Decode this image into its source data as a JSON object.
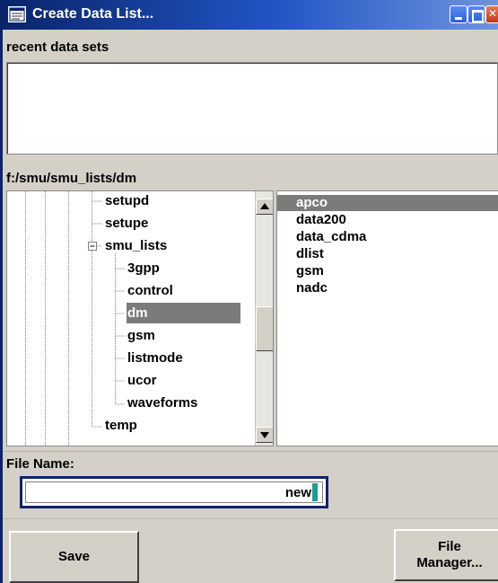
{
  "window": {
    "title": "Create Data List...",
    "icon": "data-list-icon"
  },
  "recent": {
    "label": "recent data sets",
    "items": []
  },
  "path": "f:/smu/smu_lists/dm",
  "tree": {
    "items": [
      {
        "label": "setupd",
        "depth": 1,
        "expander": false
      },
      {
        "label": "setupe",
        "depth": 1,
        "expander": false
      },
      {
        "label": "smu_lists",
        "depth": 1,
        "expander": true
      },
      {
        "label": "3gpp",
        "depth": 2,
        "expander": false
      },
      {
        "label": "control",
        "depth": 2,
        "expander": false
      },
      {
        "label": "dm",
        "depth": 2,
        "expander": false,
        "selected": true
      },
      {
        "label": "gsm",
        "depth": 2,
        "expander": false
      },
      {
        "label": "listmode",
        "depth": 2,
        "expander": false
      },
      {
        "label": "ucor",
        "depth": 2,
        "expander": false
      },
      {
        "label": "waveforms",
        "depth": 2,
        "expander": false
      },
      {
        "label": "temp",
        "depth": 1,
        "expander": false
      }
    ]
  },
  "files": {
    "items": [
      "apco",
      "data200",
      "data_cdma",
      "dlist",
      "gsm",
      "nadc"
    ],
    "selected": "apco"
  },
  "filename": {
    "label": "File Name:",
    "value": "new"
  },
  "buttons": {
    "save": "Save",
    "file_manager_line1": "File",
    "file_manager_line2": "Manager..."
  },
  "colors": {
    "selection": "#7b7b7b",
    "focus_border": "#0a246a",
    "caret": "#1aa090"
  }
}
